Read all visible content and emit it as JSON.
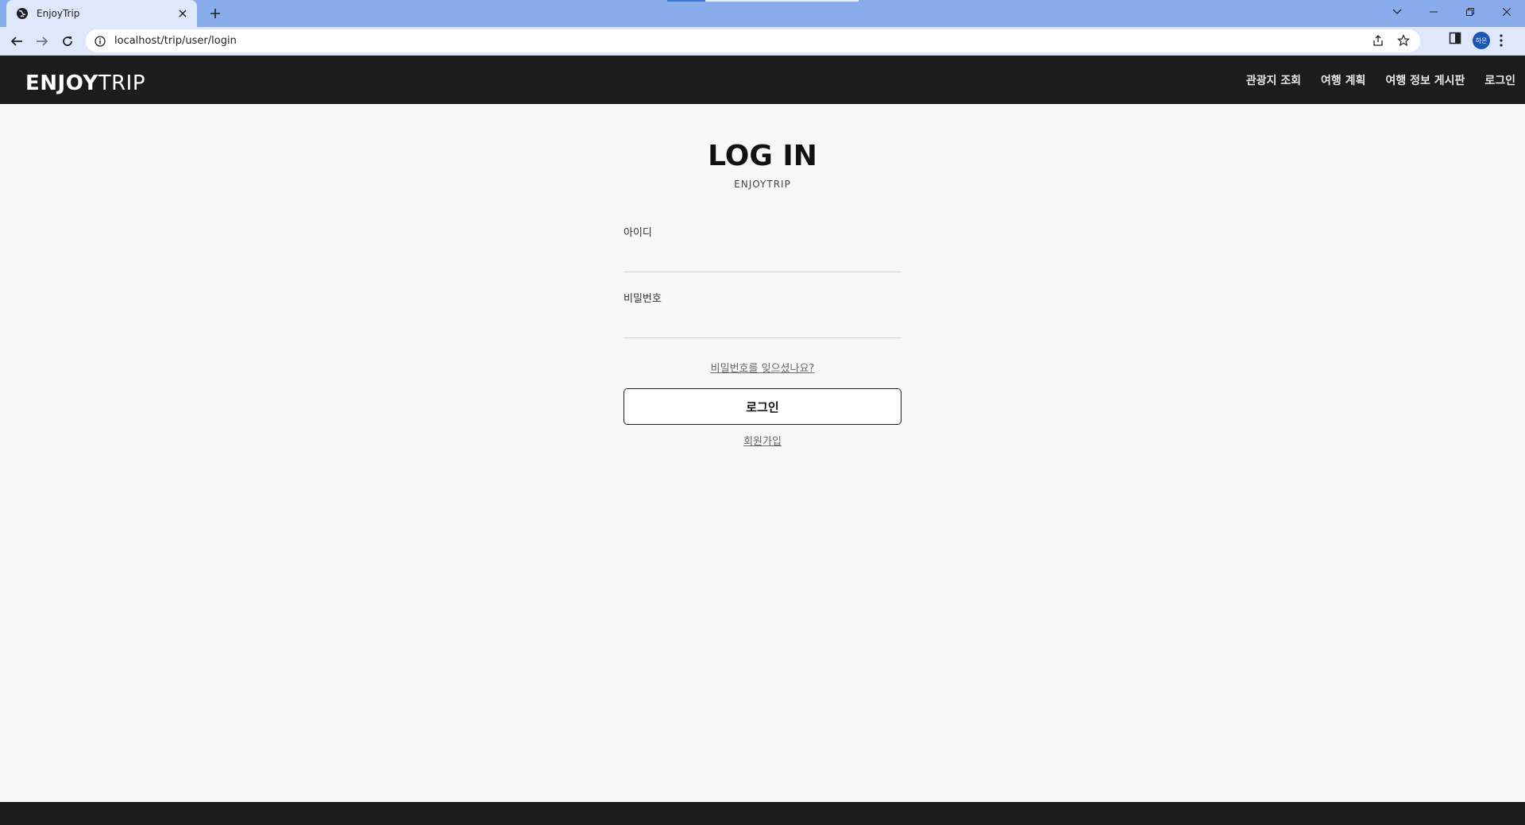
{
  "browser": {
    "tab_title": "EnjoyTrip",
    "url": "localhost/trip/user/login",
    "profile_initials": "하은"
  },
  "header": {
    "brand_bold": "ENJOY",
    "brand_light": "TRIP",
    "nav": [
      {
        "label": "관광지 조회"
      },
      {
        "label": "여행 계획"
      },
      {
        "label": "여행 정보 게시판"
      },
      {
        "label": "로그인"
      }
    ]
  },
  "login": {
    "title": "LOG IN",
    "subtitle": "ENJOYTRIP",
    "id_label": "아이디",
    "id_value": "",
    "password_label": "비밀번호",
    "password_value": "",
    "forgot_link": "비밀번호를 잊으셨나요?",
    "submit_label": "로그인",
    "signup_link": "회원가입"
  },
  "colors": {
    "tabstrip": "#89acec",
    "toolbar": "#dfe8fb",
    "header_bg": "#1c1c1c",
    "page_bg": "#f8f8f8"
  }
}
